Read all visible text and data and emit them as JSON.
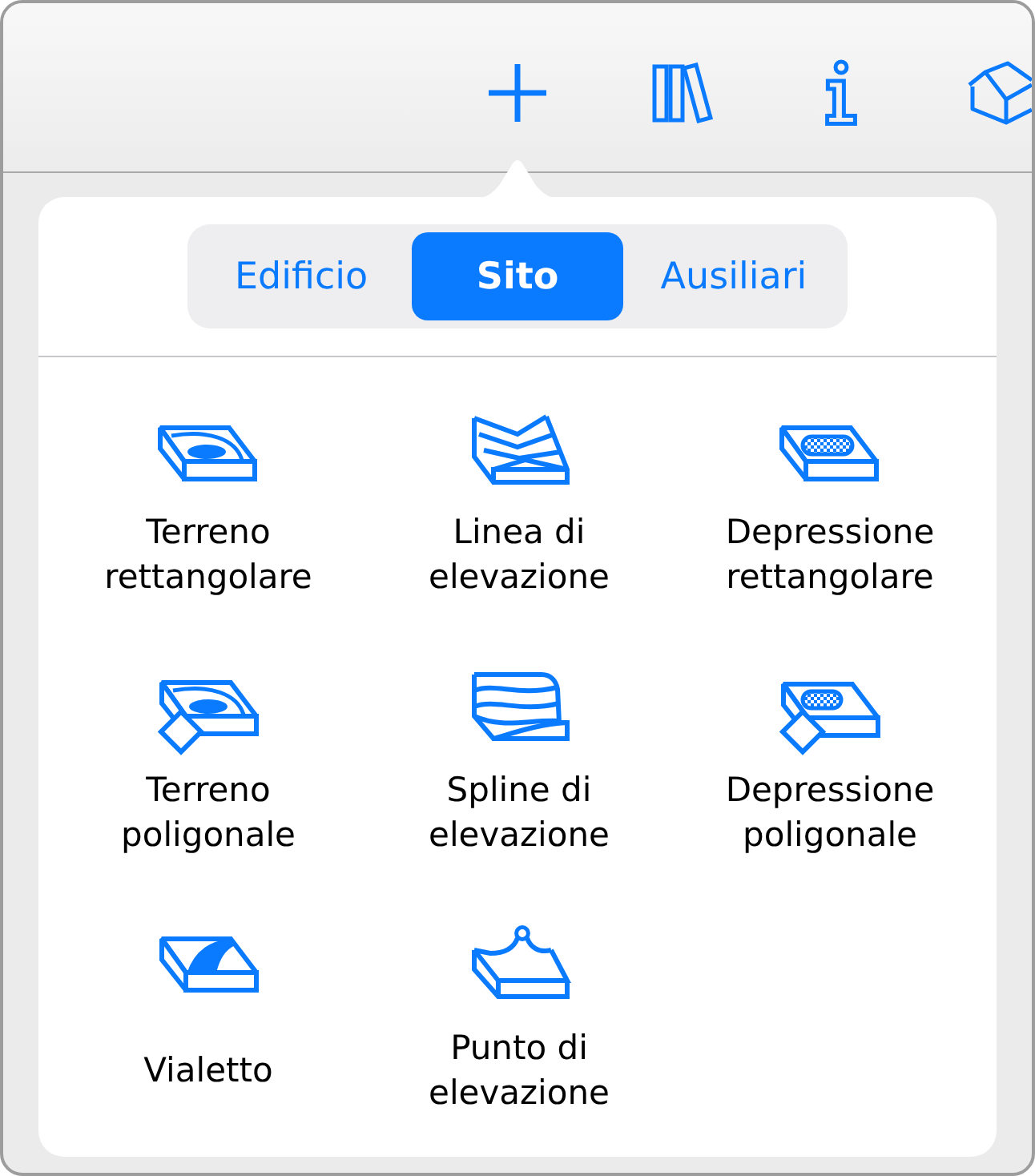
{
  "segments": [
    {
      "label": "Edificio",
      "selected": false
    },
    {
      "label": "Sito",
      "selected": true
    },
    {
      "label": "Ausiliari",
      "selected": false
    }
  ],
  "tools": [
    {
      "label": "Terreno rettangolare"
    },
    {
      "label": "Linea di elevazione"
    },
    {
      "label": "Depressione rettangolare"
    },
    {
      "label": "Terreno poligonale"
    },
    {
      "label": "Spline di elevazione"
    },
    {
      "label": "Depressione poligonale"
    },
    {
      "label": "Vialetto"
    },
    {
      "label": "Punto di elevazione"
    }
  ]
}
